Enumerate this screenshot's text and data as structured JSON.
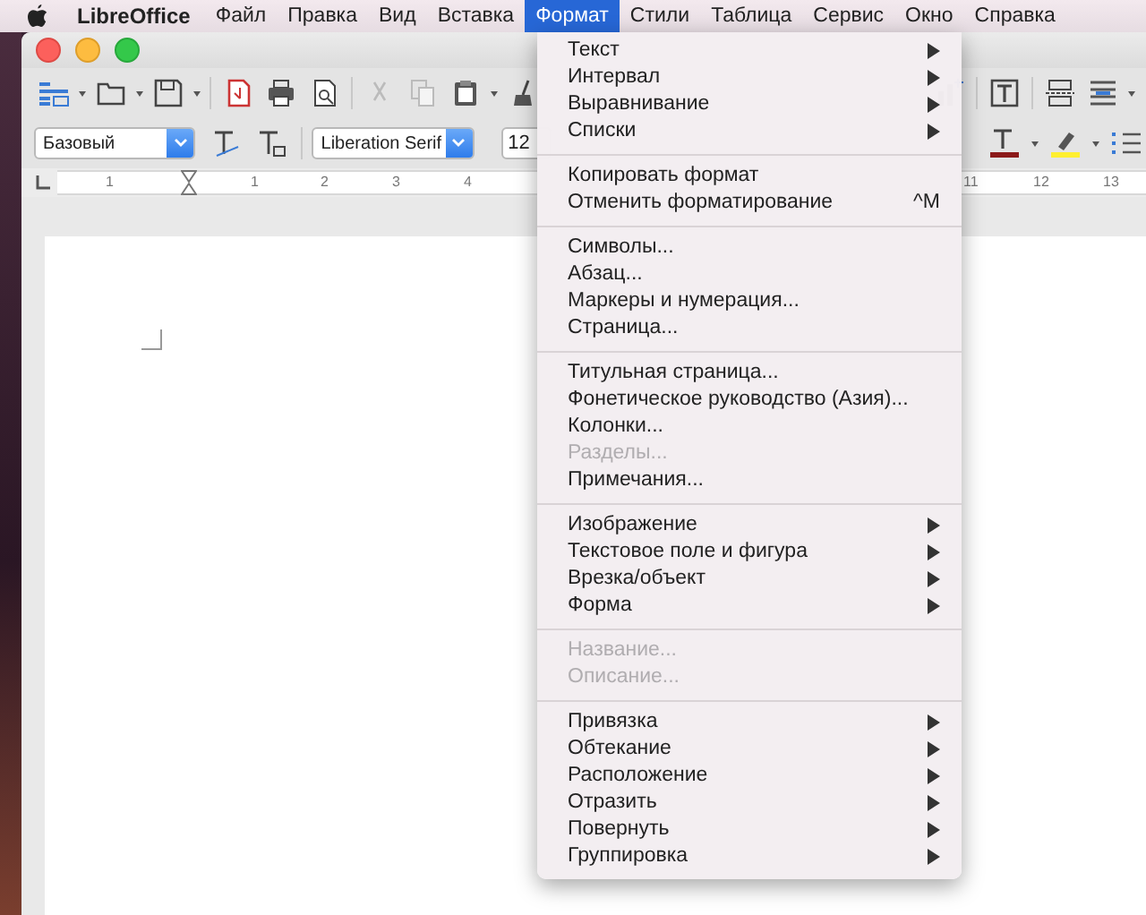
{
  "menubar": {
    "app_name": "LibreOffice",
    "menus": [
      {
        "label": "Файл",
        "selected": false
      },
      {
        "label": "Правка",
        "selected": false
      },
      {
        "label": "Вид",
        "selected": false
      },
      {
        "label": "Вставка",
        "selected": false
      },
      {
        "label": "Формат",
        "selected": true
      },
      {
        "label": "Стили",
        "selected": false
      },
      {
        "label": "Таблица",
        "selected": false
      },
      {
        "label": "Сервис",
        "selected": false
      },
      {
        "label": "Окно",
        "selected": false
      },
      {
        "label": "Справка",
        "selected": false
      }
    ]
  },
  "toolbar": {
    "paragraph_style": "Базовый",
    "font_name": "Liberation Serif",
    "font_size": "12"
  },
  "ruler": {
    "left_labels": [
      "1",
      "1",
      "2",
      "3",
      "4"
    ],
    "right_labels": [
      "11",
      "12",
      "13"
    ]
  },
  "format_menu": {
    "sections": [
      [
        {
          "label": "Текст",
          "submenu": true,
          "disabled": false
        },
        {
          "label": "Интервал",
          "submenu": true,
          "disabled": false
        },
        {
          "label": "Выравнивание",
          "submenu": true,
          "disabled": false
        },
        {
          "label": "Списки",
          "submenu": true,
          "disabled": false
        }
      ],
      [
        {
          "label": "Копировать формат",
          "submenu": false,
          "disabled": false
        },
        {
          "label": "Отменить форматирование",
          "submenu": false,
          "disabled": false,
          "shortcut": "^M"
        }
      ],
      [
        {
          "label": "Символы...",
          "submenu": false,
          "disabled": false
        },
        {
          "label": "Абзац...",
          "submenu": false,
          "disabled": false
        },
        {
          "label": "Маркеры и нумерация...",
          "submenu": false,
          "disabled": false
        },
        {
          "label": "Страница...",
          "submenu": false,
          "disabled": false
        }
      ],
      [
        {
          "label": "Титульная страница...",
          "submenu": false,
          "disabled": false
        },
        {
          "label": "Фонетическое руководство (Азия)...",
          "submenu": false,
          "disabled": false
        },
        {
          "label": "Колонки...",
          "submenu": false,
          "disabled": false
        },
        {
          "label": "Разделы...",
          "submenu": false,
          "disabled": true
        },
        {
          "label": "Примечания...",
          "submenu": false,
          "disabled": false
        }
      ],
      [
        {
          "label": "Изображение",
          "submenu": true,
          "disabled": false
        },
        {
          "label": "Текстовое поле и фигура",
          "submenu": true,
          "disabled": false
        },
        {
          "label": "Врезка/объект",
          "submenu": true,
          "disabled": false
        },
        {
          "label": "Форма",
          "submenu": true,
          "disabled": false
        }
      ],
      [
        {
          "label": "Название...",
          "submenu": false,
          "disabled": true
        },
        {
          "label": "Описание...",
          "submenu": false,
          "disabled": true
        }
      ],
      [
        {
          "label": "Привязка",
          "submenu": true,
          "disabled": false
        },
        {
          "label": "Обтекание",
          "submenu": true,
          "disabled": false
        },
        {
          "label": "Расположение",
          "submenu": true,
          "disabled": false
        },
        {
          "label": "Отразить",
          "submenu": true,
          "disabled": false
        },
        {
          "label": "Повернуть",
          "submenu": true,
          "disabled": false
        },
        {
          "label": "Группировка",
          "submenu": true,
          "disabled": false
        }
      ]
    ]
  }
}
